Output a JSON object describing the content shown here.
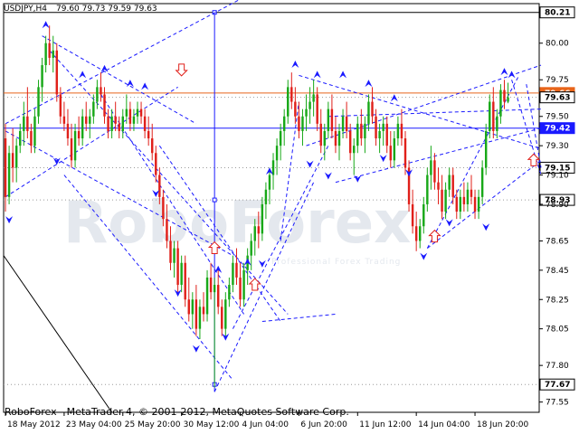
{
  "chart_data": {
    "type": "candlestick",
    "symbol_label": "USDJPY,H4",
    "ohlc_label": "79.60 79.73 79.59 79.63",
    "footer": "RoboForex - MetaTrader 4, © 2001-2012, MetaQuotes Software Corp.",
    "watermark": "RoboForex",
    "watermark_sub": "Professional Forex Trading",
    "y_ticks": [
      "80.00",
      "79.75",
      "79.50",
      "79.30",
      "79.10",
      "78.90",
      "78.65",
      "78.45",
      "78.25",
      "78.05",
      "77.80",
      "77.55"
    ],
    "y_tick_values": [
      80.0,
      79.75,
      79.5,
      79.3,
      79.1,
      78.9,
      78.65,
      78.45,
      78.25,
      78.05,
      77.8,
      77.55
    ],
    "x_ticks": [
      "18 May 2012",
      "23 May 04:00",
      "25 May 20:00",
      "30 May 12:00",
      "4 Jun 04:00",
      "6 Jun 20:00",
      "11 Jun 12:00",
      "14 Jun 04:00",
      "18 Jun 20:00"
    ],
    "x_tick_index": [
      0,
      16,
      32,
      48,
      64,
      80,
      96,
      112,
      128
    ],
    "levels": [
      {
        "value": 80.21,
        "label": "80.21",
        "color": "#000000",
        "badge": "#ffffff"
      },
      {
        "value": 79.66,
        "label": "79.66",
        "color": "#e8651a",
        "badge": "#e8651a"
      },
      {
        "value": 79.63,
        "label": "79.63",
        "color": null,
        "badge": "#ffffff"
      },
      {
        "value": 79.42,
        "label": "79.42",
        "color": "#1a1aff",
        "badge": "#1a1aff"
      },
      {
        "value": 79.15,
        "label": "79.15",
        "color": null,
        "badge": "#ffffff"
      },
      {
        "value": 78.93,
        "label": "78.93",
        "color": null,
        "badge": "#ffffff"
      },
      {
        "value": 77.67,
        "label": "77.67",
        "color": null,
        "badge": "#ffffff"
      }
    ],
    "y_range": [
      77.48,
      80.27
    ],
    "bars_count": 146,
    "vline_index": 57,
    "colors": {
      "up": "#18a818",
      "down": "#e0201a",
      "trend": "#1a1aff",
      "support": "#1a1aff",
      "resistance": "#e8651a"
    },
    "candles": [
      [
        79.35,
        79.45,
        78.85,
        78.95
      ],
      [
        78.95,
        79.3,
        78.9,
        79.25
      ],
      [
        79.25,
        79.42,
        79.05,
        79.15
      ],
      [
        79.15,
        79.35,
        79.05,
        79.3
      ],
      [
        79.3,
        79.45,
        79.25,
        79.4
      ],
      [
        79.4,
        79.6,
        79.3,
        79.5
      ],
      [
        79.5,
        79.7,
        79.35,
        79.4
      ],
      [
        79.4,
        79.45,
        79.25,
        79.3
      ],
      [
        79.3,
        79.55,
        79.25,
        79.5
      ],
      [
        79.5,
        79.75,
        79.45,
        79.7
      ],
      [
        79.7,
        79.9,
        79.6,
        79.85
      ],
      [
        79.85,
        80.05,
        79.8,
        80.0
      ],
      [
        80.0,
        80.12,
        79.85,
        79.9
      ],
      [
        79.9,
        80.05,
        79.8,
        79.95
      ],
      [
        79.95,
        80.0,
        79.6,
        79.65
      ],
      [
        79.65,
        79.7,
        79.45,
        79.5
      ],
      [
        79.5,
        79.6,
        79.4,
        79.45
      ],
      [
        79.45,
        79.55,
        79.3,
        79.35
      ],
      [
        79.35,
        79.45,
        79.15,
        79.2
      ],
      [
        79.2,
        79.45,
        79.15,
        79.4
      ],
      [
        79.4,
        79.5,
        79.3,
        79.35
      ],
      [
        79.35,
        79.55,
        79.3,
        79.5
      ],
      [
        79.5,
        79.6,
        79.4,
        79.45
      ],
      [
        79.45,
        79.55,
        79.35,
        79.5
      ],
      [
        79.5,
        79.65,
        79.45,
        79.6
      ],
      [
        79.6,
        79.75,
        79.55,
        79.7
      ],
      [
        79.7,
        79.8,
        79.6,
        79.65
      ],
      [
        79.65,
        79.7,
        79.45,
        79.5
      ],
      [
        79.5,
        79.55,
        79.35,
        79.4
      ],
      [
        79.4,
        79.55,
        79.35,
        79.5
      ],
      [
        79.5,
        79.6,
        79.4,
        79.45
      ],
      [
        79.45,
        79.5,
        79.35,
        79.4
      ],
      [
        79.4,
        79.55,
        79.35,
        79.5
      ],
      [
        79.5,
        79.65,
        79.45,
        79.55
      ],
      [
        79.55,
        79.6,
        79.4,
        79.45
      ],
      [
        79.45,
        79.55,
        79.4,
        79.5
      ],
      [
        79.5,
        79.6,
        79.45,
        79.55
      ],
      [
        79.55,
        79.6,
        79.45,
        79.5
      ],
      [
        79.5,
        79.55,
        79.35,
        79.4
      ],
      [
        79.4,
        79.5,
        79.3,
        79.35
      ],
      [
        79.35,
        79.45,
        79.2,
        79.25
      ],
      [
        79.25,
        79.3,
        79.05,
        79.1
      ],
      [
        79.1,
        79.15,
        78.9,
        78.95
      ],
      [
        78.95,
        79.0,
        78.75,
        78.8
      ],
      [
        78.8,
        78.9,
        78.6,
        78.65
      ],
      [
        78.65,
        78.75,
        78.45,
        78.5
      ],
      [
        78.5,
        78.65,
        78.4,
        78.6
      ],
      [
        78.6,
        78.65,
        78.3,
        78.35
      ],
      [
        78.35,
        78.55,
        78.3,
        78.5
      ],
      [
        78.5,
        78.55,
        78.2,
        78.25
      ],
      [
        78.25,
        78.4,
        78.1,
        78.15
      ],
      [
        78.15,
        78.3,
        78.05,
        78.25
      ],
      [
        78.25,
        78.35,
        78.0,
        78.05
      ],
      [
        78.05,
        78.25,
        77.98,
        78.2
      ],
      [
        78.2,
        78.3,
        78.1,
        78.15
      ],
      [
        78.15,
        78.45,
        78.1,
        78.4
      ],
      [
        78.4,
        78.5,
        78.25,
        78.3
      ],
      [
        78.3,
        78.4,
        77.65,
        78.35
      ],
      [
        78.35,
        78.45,
        78.15,
        78.2
      ],
      [
        78.2,
        78.25,
        78.0,
        78.05
      ],
      [
        78.05,
        78.3,
        78.0,
        78.25
      ],
      [
        78.25,
        78.4,
        78.2,
        78.35
      ],
      [
        78.35,
        78.55,
        78.3,
        78.5
      ],
      [
        78.5,
        78.6,
        78.35,
        78.4
      ],
      [
        78.4,
        78.5,
        78.2,
        78.25
      ],
      [
        78.25,
        78.5,
        78.2,
        78.45
      ],
      [
        78.45,
        78.6,
        78.35,
        78.55
      ],
      [
        78.55,
        78.7,
        78.45,
        78.65
      ],
      [
        78.65,
        78.8,
        78.55,
        78.75
      ],
      [
        78.75,
        78.85,
        78.6,
        78.7
      ],
      [
        78.7,
        78.95,
        78.65,
        78.9
      ],
      [
        78.9,
        79.05,
        78.8,
        79.0
      ],
      [
        79.0,
        79.15,
        78.9,
        79.1
      ],
      [
        79.1,
        79.25,
        79.0,
        79.2
      ],
      [
        79.2,
        79.35,
        79.1,
        79.3
      ],
      [
        79.3,
        79.45,
        79.2,
        79.4
      ],
      [
        79.4,
        79.55,
        79.3,
        79.5
      ],
      [
        79.5,
        79.75,
        79.45,
        79.7
      ],
      [
        79.7,
        79.8,
        79.55,
        79.6
      ],
      [
        79.6,
        79.7,
        79.45,
        79.5
      ],
      [
        79.5,
        79.6,
        79.35,
        79.4
      ],
      [
        79.4,
        79.55,
        79.3,
        79.5
      ],
      [
        79.5,
        79.65,
        79.4,
        79.55
      ],
      [
        79.55,
        79.7,
        79.45,
        79.6
      ],
      [
        79.6,
        79.75,
        79.5,
        79.65
      ],
      [
        79.65,
        79.7,
        79.4,
        79.45
      ],
      [
        79.45,
        79.55,
        79.25,
        79.3
      ],
      [
        79.3,
        79.45,
        79.2,
        79.4
      ],
      [
        79.4,
        79.6,
        79.35,
        79.55
      ],
      [
        79.55,
        79.65,
        79.35,
        79.4
      ],
      [
        79.4,
        79.5,
        79.25,
        79.3
      ],
      [
        79.3,
        79.45,
        79.2,
        79.4
      ],
      [
        79.4,
        79.55,
        79.35,
        79.5
      ],
      [
        79.5,
        79.6,
        79.35,
        79.4
      ],
      [
        79.4,
        79.45,
        79.2,
        79.25
      ],
      [
        79.25,
        79.35,
        79.1,
        79.3
      ],
      [
        79.3,
        79.5,
        79.25,
        79.45
      ],
      [
        79.45,
        79.55,
        79.3,
        79.35
      ],
      [
        79.35,
        79.5,
        79.25,
        79.45
      ],
      [
        79.45,
        79.65,
        79.4,
        79.6
      ],
      [
        79.6,
        79.7,
        79.45,
        79.5
      ],
      [
        79.5,
        79.55,
        79.3,
        79.35
      ],
      [
        79.35,
        79.45,
        79.25,
        79.4
      ],
      [
        79.4,
        79.5,
        79.3,
        79.45
      ],
      [
        79.45,
        79.5,
        79.25,
        79.3
      ],
      [
        79.3,
        79.4,
        79.15,
        79.2
      ],
      [
        79.2,
        79.4,
        79.15,
        79.35
      ],
      [
        79.35,
        79.5,
        79.3,
        79.45
      ],
      [
        79.45,
        79.55,
        79.3,
        79.35
      ],
      [
        79.35,
        79.4,
        79.1,
        79.15
      ],
      [
        79.15,
        79.2,
        78.85,
        78.9
      ],
      [
        78.9,
        79.0,
        78.7,
        78.75
      ],
      [
        78.75,
        78.85,
        78.58,
        78.65
      ],
      [
        78.65,
        78.8,
        78.6,
        78.75
      ],
      [
        78.75,
        78.95,
        78.7,
        78.9
      ],
      [
        78.9,
        79.15,
        78.85,
        79.1
      ],
      [
        79.1,
        79.3,
        79.0,
        79.2
      ],
      [
        79.2,
        79.25,
        79.0,
        79.05
      ],
      [
        79.05,
        79.15,
        78.9,
        79.0
      ],
      [
        79.0,
        79.1,
        78.8,
        78.85
      ],
      [
        78.85,
        79.05,
        78.8,
        79.0
      ],
      [
        79.0,
        79.15,
        78.95,
        79.1
      ],
      [
        79.1,
        79.15,
        78.9,
        78.95
      ],
      [
        78.95,
        79.0,
        78.8,
        78.85
      ],
      [
        78.85,
        79.0,
        78.8,
        78.95
      ],
      [
        78.95,
        79.05,
        78.85,
        78.9
      ],
      [
        78.9,
        79.05,
        78.85,
        79.0
      ],
      [
        79.0,
        79.1,
        78.9,
        78.95
      ],
      [
        78.95,
        79.0,
        78.8,
        78.85
      ],
      [
        78.85,
        79.0,
        78.8,
        78.95
      ],
      [
        78.95,
        79.2,
        78.9,
        79.15
      ],
      [
        79.15,
        79.45,
        79.1,
        79.4
      ],
      [
        79.4,
        79.65,
        79.35,
        79.6
      ],
      [
        79.6,
        79.7,
        79.35,
        79.4
      ],
      [
        79.4,
        79.55,
        79.35,
        79.5
      ],
      [
        79.5,
        79.72,
        79.45,
        79.68
      ],
      [
        79.68,
        79.75,
        79.55,
        79.6
      ],
      [
        79.6,
        79.73,
        79.59,
        79.63
      ]
    ]
  }
}
